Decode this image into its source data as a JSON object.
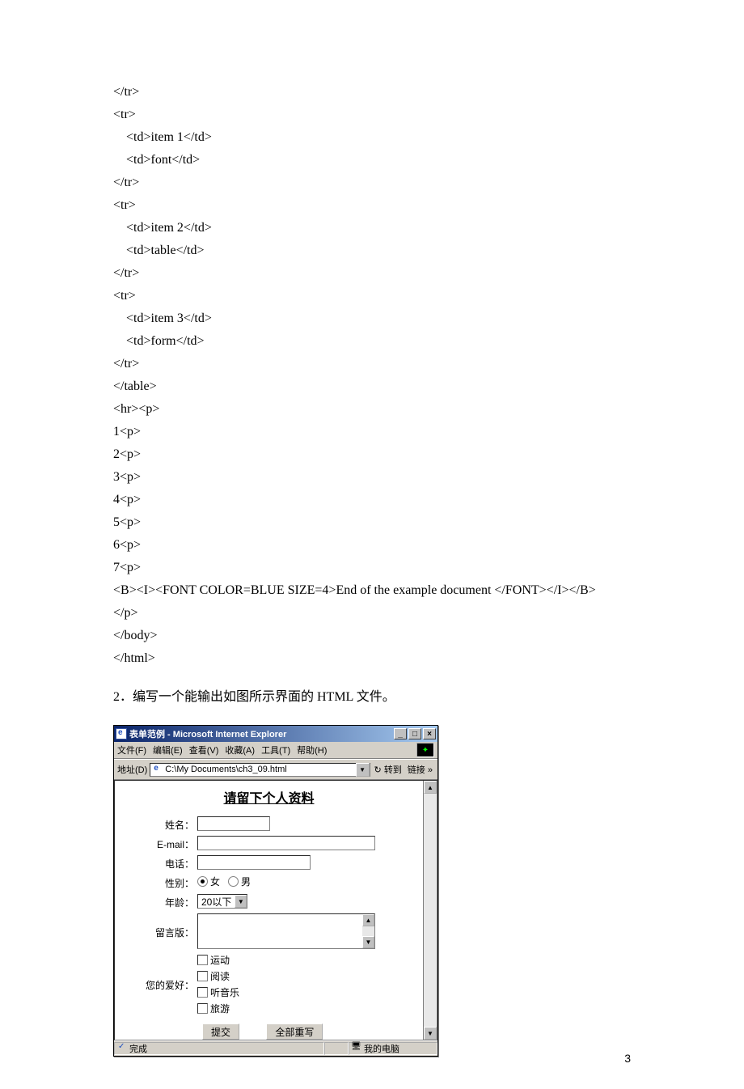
{
  "code_lines": [
    "</tr>",
    "<tr>",
    "    <td>item 1</td>",
    "    <td>font</td>",
    "</tr>",
    "<tr>",
    "    <td>item 2</td>",
    "    <td>table</td>",
    "</tr>",
    "<tr>",
    "    <td>item 3</td>",
    "    <td>form</td>",
    "</tr>",
    "</table>",
    "<hr><p>",
    "1<p>",
    "2<p>",
    "3<p>",
    "4<p>",
    "5<p>",
    "6<p>",
    "7<p>",
    "<B><I><FONT COLOR=BLUE SIZE=4>End of the example document </FONT></I></B>",
    "</p>",
    "</body>",
    "</html>"
  ],
  "question": "2．编写一个能输出如图所示界面的 HTML 文件。",
  "page_number": "3",
  "ie": {
    "title": "表单范例 - Microsoft Internet Explorer",
    "menus": [
      "文件(F)",
      "编辑(E)",
      "查看(V)",
      "收藏(A)",
      "工具(T)",
      "帮助(H)"
    ],
    "addr_label": "地址(D)",
    "addr_value": "C:\\My Documents\\ch3_09.html",
    "go_label": "转到",
    "links_label": "链接 »",
    "status_done": "完成",
    "status_zone": "我的电脑",
    "form": {
      "heading": "请留下个人资料",
      "name_label": "姓名：",
      "email_label": "E-mail：",
      "phone_label": "电话：",
      "gender_label": "性别：",
      "gender_f": "女",
      "gender_m": "男",
      "age_label": "年龄：",
      "age_selected": "20以下",
      "msg_label": "留言版：",
      "hobby_label": "您的爱好：",
      "hobbies": [
        "运动",
        "阅读",
        "听音乐",
        "旅游"
      ],
      "submit": "提交",
      "reset": "全部重写"
    }
  }
}
